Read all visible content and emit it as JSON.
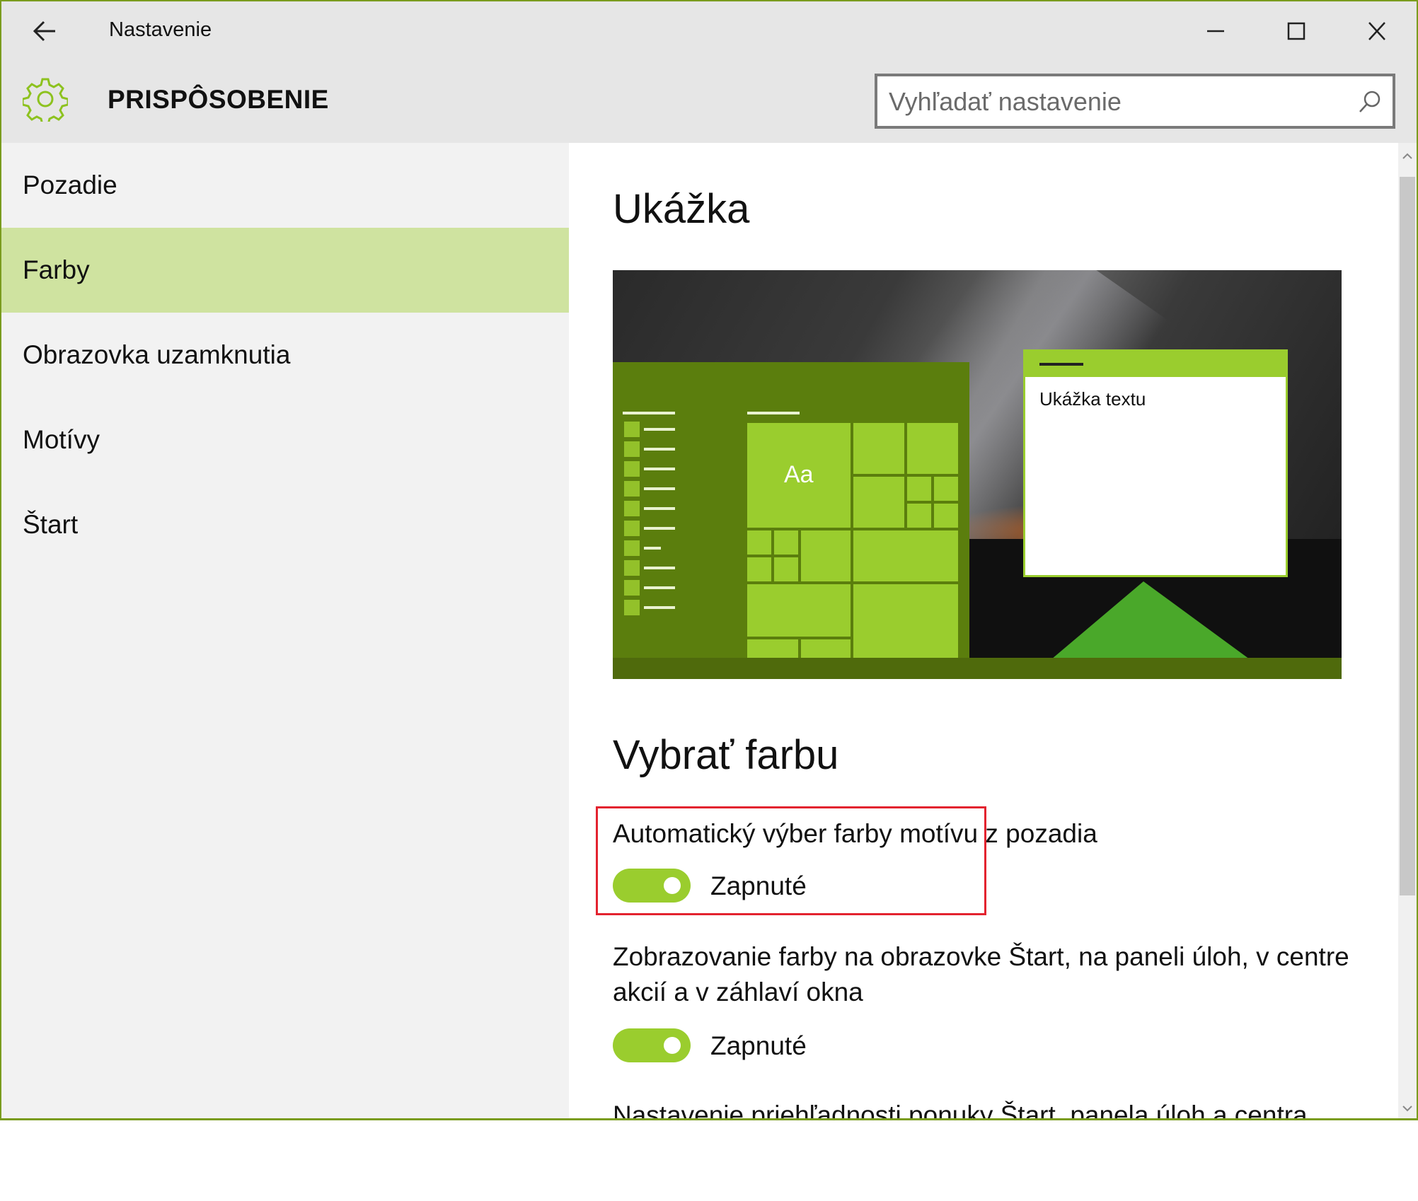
{
  "window": {
    "title": "Nastavenie"
  },
  "header": {
    "title": "PRISPÔSOBENIE",
    "search_placeholder": "Vyhľadať nastavenie"
  },
  "sidebar": {
    "items": [
      {
        "label": "Pozadie",
        "selected": false
      },
      {
        "label": "Farby",
        "selected": true
      },
      {
        "label": "Obrazovka uzamknutia",
        "selected": false
      },
      {
        "label": "Motívy",
        "selected": false
      },
      {
        "label": "Štart",
        "selected": false
      }
    ]
  },
  "main": {
    "preview_heading": "Ukážka",
    "preview": {
      "tile_text": "Aa",
      "sample_text": "Ukážka textu"
    },
    "color_heading": "Vybrať farbu",
    "settings": [
      {
        "label": "Automatický výber farby motívu z pozadia",
        "state": "Zapnuté",
        "on": true
      },
      {
        "label_line1": "Zobrazovanie farby na obrazovke Štart, na paneli úloh, v centre",
        "label_line2": "akcií a v záhlaví okna",
        "state": "Zapnuté",
        "on": true
      },
      {
        "label": "Nastavenie priehľadnosti ponuky Štart, panela úloh a centra"
      }
    ]
  },
  "colors": {
    "accent": "#9acd2e",
    "selected_nav": "#cfe3a0",
    "highlight_border": "#e3232f",
    "window_border": "#7a9c1e"
  },
  "icons": {
    "back": "back-arrow-icon",
    "gear": "gear-icon",
    "search": "search-icon",
    "minimize": "minimize-icon",
    "maximize": "maximize-icon",
    "close": "close-icon"
  }
}
